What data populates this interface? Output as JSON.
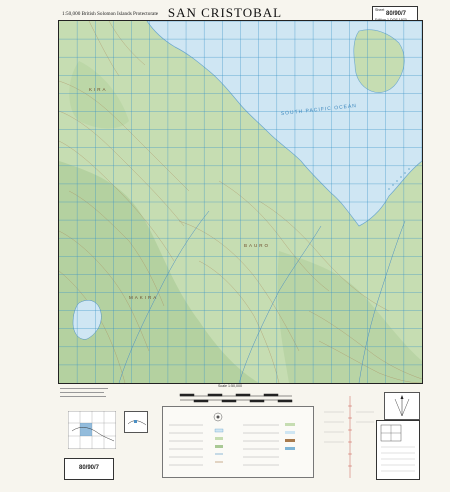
{
  "header": {
    "scale_text": "1:50,000 British Solomon Islands Protectorate",
    "title": "SAN CRISTOBAL",
    "sheet_label": "Sheet",
    "sheet_number": "80/90/7",
    "edition_text": "Edition 1 DOS 1970"
  },
  "map": {
    "sea_label": "SOUTH PACIFIC OCEAN",
    "region_label_1": "BAURO",
    "region_label_2": "MAKIRA",
    "region_label_3": "KIRA"
  },
  "legend": {
    "scale_title": "Scale 1:50,000",
    "bottom_sheet_number": "80/90/7",
    "bottom_edition": "Edition 1 DOS 1970"
  },
  "colors": {
    "sea": "#cfe6f3",
    "land": "#c6ddb2",
    "land_dark": "#a9c995",
    "grid": "#3a93c7",
    "contour": "#a87a4d",
    "frame": "#222222",
    "reef": "#7fb5d6"
  }
}
